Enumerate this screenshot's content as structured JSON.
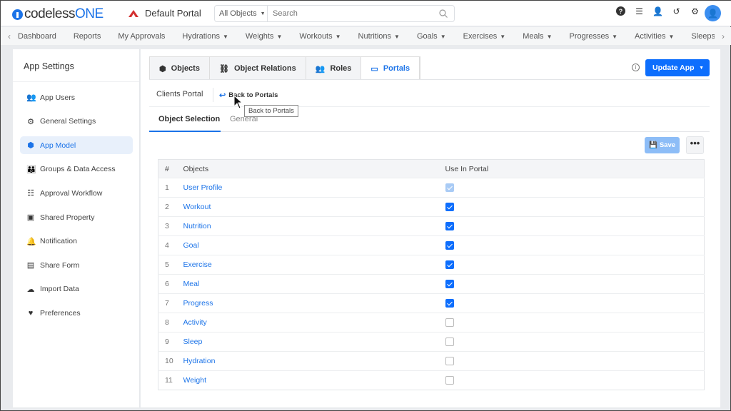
{
  "header": {
    "logo_text_1": "codeless",
    "logo_text_2": "ONE",
    "portal_name": "Default Portal",
    "search_scope": "All Objects",
    "search_placeholder": "Search",
    "icons": [
      "help-icon",
      "database-icon",
      "add-user-icon",
      "history-icon",
      "gear-icon",
      "user-avatar-icon"
    ]
  },
  "nav": {
    "items": [
      {
        "label": "Dashboard"
      },
      {
        "label": "Reports"
      },
      {
        "label": "My Approvals"
      },
      {
        "label": "Hydrations",
        "dropdown": true
      },
      {
        "label": "Weights",
        "dropdown": true
      },
      {
        "label": "Workouts",
        "dropdown": true
      },
      {
        "label": "Nutritions",
        "dropdown": true
      },
      {
        "label": "Goals",
        "dropdown": true
      },
      {
        "label": "Exercises",
        "dropdown": true
      },
      {
        "label": "Meals",
        "dropdown": true
      },
      {
        "label": "Progresses",
        "dropdown": true
      },
      {
        "label": "Activities",
        "dropdown": true
      },
      {
        "label": "Sleeps"
      }
    ]
  },
  "sidebar": {
    "title": "App Settings",
    "active": "App Model",
    "items": [
      {
        "label": "App Users",
        "icon": "users-icon"
      },
      {
        "label": "General Settings",
        "icon": "gear-icon"
      },
      {
        "label": "App Model",
        "icon": "cube-icon"
      },
      {
        "label": "Groups & Data Access",
        "icon": "group-icon"
      },
      {
        "label": "Approval Workflow",
        "icon": "checklist-icon"
      },
      {
        "label": "Shared Property",
        "icon": "inbox-icon"
      },
      {
        "label": "Notification",
        "icon": "bell-icon"
      },
      {
        "label": "Share Form",
        "icon": "form-icon"
      },
      {
        "label": "Import Data",
        "icon": "cloud-upload-icon"
      },
      {
        "label": "Preferences",
        "icon": "hand-heart-icon"
      }
    ]
  },
  "main": {
    "tabs": [
      {
        "label": "Objects"
      },
      {
        "label": "Object Relations"
      },
      {
        "label": "Roles"
      },
      {
        "label": "Portals",
        "active": true
      }
    ],
    "update_button": "Update App",
    "portal_title": "Clients Portal",
    "back_link": "Back to Portals",
    "tooltip": "Back to Portals",
    "subtabs": [
      {
        "label": "Object Selection",
        "active": true
      },
      {
        "label": "General"
      }
    ],
    "save_button": "Save",
    "more_button": "•••",
    "table": {
      "columns": [
        "#",
        "Objects",
        "Use In Portal"
      ],
      "rows": [
        {
          "n": "1",
          "object": "User Profile",
          "use": true,
          "disabled": true
        },
        {
          "n": "2",
          "object": "Workout",
          "use": true
        },
        {
          "n": "3",
          "object": "Nutrition",
          "use": true
        },
        {
          "n": "4",
          "object": "Goal",
          "use": true
        },
        {
          "n": "5",
          "object": "Exercise",
          "use": true
        },
        {
          "n": "6",
          "object": "Meal",
          "use": true
        },
        {
          "n": "7",
          "object": "Progress",
          "use": true
        },
        {
          "n": "8",
          "object": "Activity",
          "use": false
        },
        {
          "n": "9",
          "object": "Sleep",
          "use": false
        },
        {
          "n": "10",
          "object": "Hydration",
          "use": false
        },
        {
          "n": "11",
          "object": "Weight",
          "use": false
        }
      ]
    }
  },
  "colors": {
    "accent": "#1b73e8",
    "primary_button": "#0d6efd",
    "save_disabled": "#8dbdf7"
  }
}
